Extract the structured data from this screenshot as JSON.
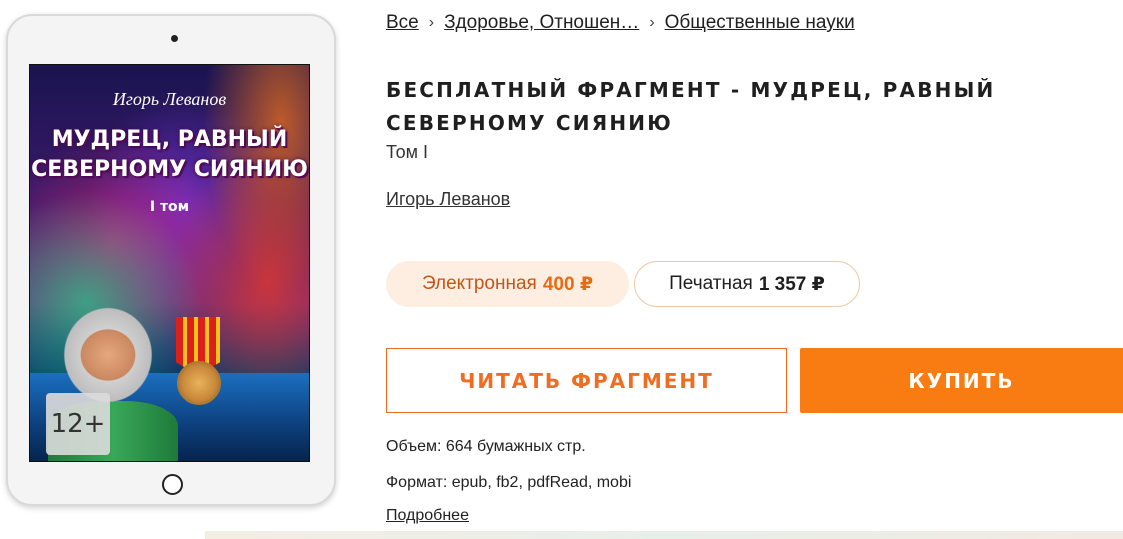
{
  "breadcrumb": {
    "items": [
      "Все",
      "Здоровье, Отношен…",
      "Общественные науки"
    ],
    "separator": "›"
  },
  "cover": {
    "author": "Игорь Леванов",
    "title_line1": "МУДРЕЦ, РАВНЫЙ",
    "title_line2": "СЕВЕРНОМУ СИЯНИЮ",
    "volume": "I том",
    "age_rating": "12+"
  },
  "book": {
    "title": "БЕСПЛАТНЫЙ ФРАГМЕНТ - МУДРЕЦ, РАВНЫЙ СЕВЕРНОМУ СИЯНИЮ",
    "volume": "Том I",
    "author": "Игорь Леванов"
  },
  "formats": {
    "ebook": {
      "label": "Электронная",
      "price": "400 ₽"
    },
    "print": {
      "label": "Печатная",
      "price": "1 357 ₽"
    }
  },
  "actions": {
    "read_label": "ЧИТАТЬ ФРАГМЕНТ",
    "buy_label": "КУПИТЬ"
  },
  "meta": {
    "pages": "Объем: 664 бумажных стр.",
    "formats": "Формат: epub, fb2, pdfRead, mobi",
    "more": "Подробнее"
  },
  "colors": {
    "accent": "#f97c12",
    "accent_text": "#ef6d22",
    "ebook_pill_bg": "#fdeee1"
  }
}
